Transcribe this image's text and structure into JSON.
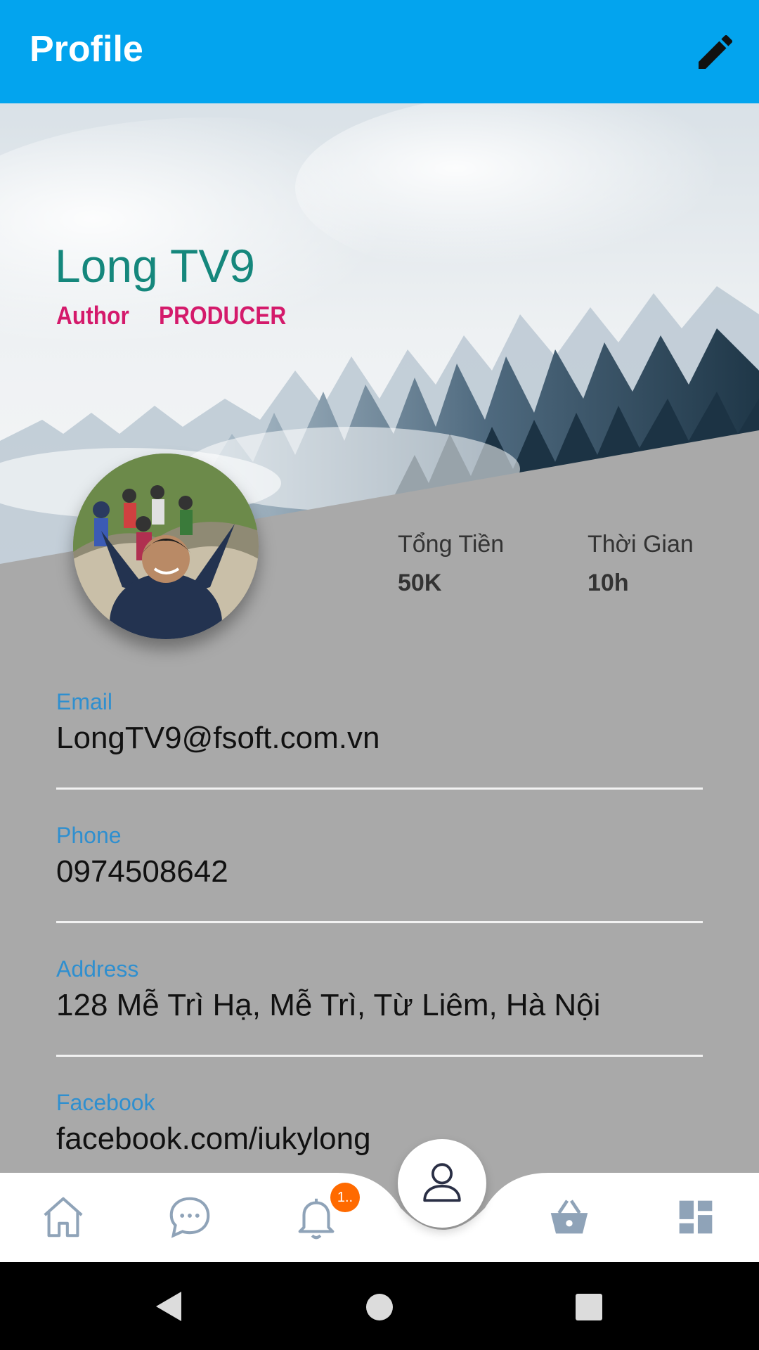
{
  "header": {
    "title": "Profile",
    "edit_icon": "pencil-icon"
  },
  "profile": {
    "name": "Long TV9",
    "roles": [
      "Author",
      "PRODUCER"
    ]
  },
  "stats": [
    {
      "label": "Tổng Tiền",
      "value": "50K"
    },
    {
      "label": "Thời Gian",
      "value": "10h"
    }
  ],
  "fields": [
    {
      "label": "Email",
      "value": "LongTV9@fsoft.com.vn"
    },
    {
      "label": "Phone",
      "value": "0974508642"
    },
    {
      "label": "Address",
      "value": "128 Mễ Trì Hạ, Mễ Trì, Từ Liêm, Hà Nội"
    },
    {
      "label": "Facebook",
      "value": "facebook.com/iukylong"
    }
  ],
  "bottom_nav": {
    "items": [
      "home-icon",
      "chat-icon",
      "bell-icon",
      "profile-icon",
      "basket-icon",
      "dashboard-icon"
    ],
    "notification_badge": "1..",
    "active": "profile-icon"
  },
  "colors": {
    "appbar": "#03a4ee",
    "name": "#15877c",
    "roles": "#d41a6b",
    "field_label": "#2f8fcf",
    "background": "#a9a9a9",
    "badge": "#ff6a00"
  }
}
